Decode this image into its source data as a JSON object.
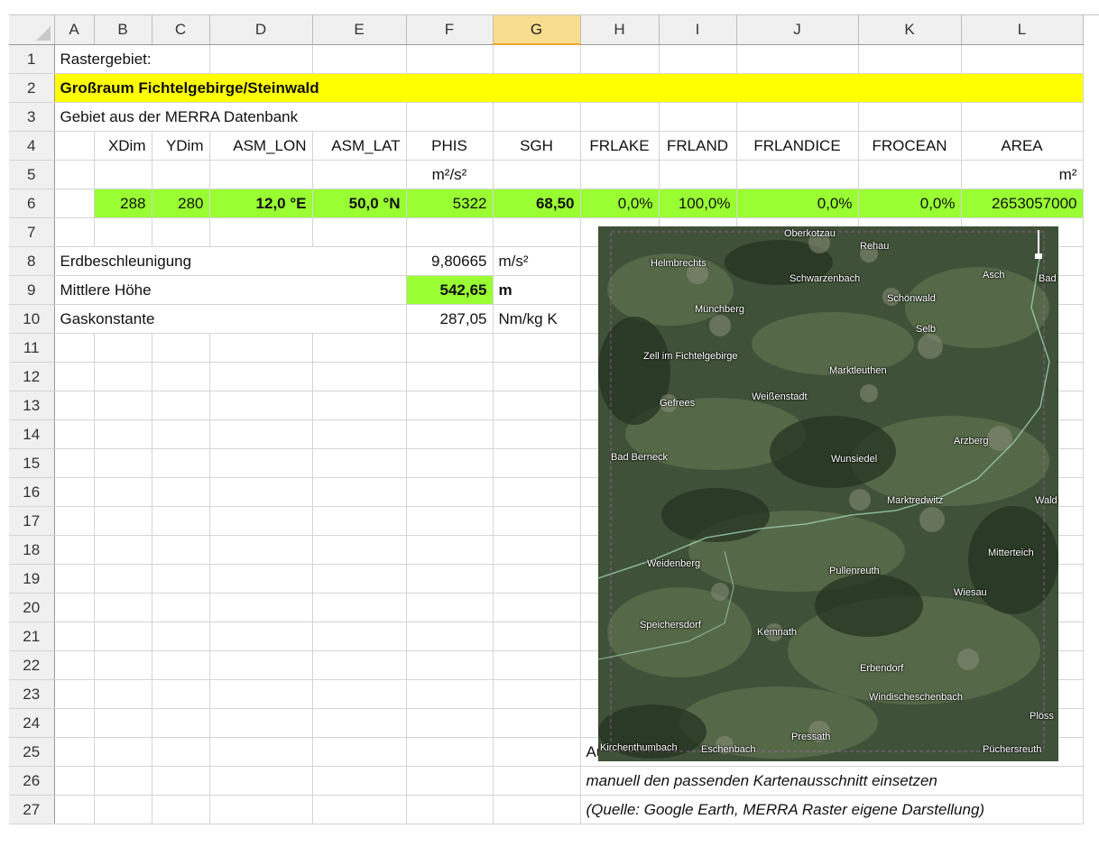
{
  "columns": [
    "A",
    "B",
    "C",
    "D",
    "E",
    "F",
    "G",
    "H",
    "I",
    "J",
    "K",
    "L"
  ],
  "rows": [
    "1",
    "2",
    "3",
    "4",
    "5",
    "6",
    "7",
    "8",
    "9",
    "10",
    "11",
    "12",
    "13",
    "14",
    "15",
    "16",
    "17",
    "18",
    "19",
    "20",
    "21",
    "22",
    "23",
    "24",
    "25",
    "26",
    "27"
  ],
  "cells": {
    "a1": "Rastergebiet:",
    "a2": "Großraum Fichtelgebirge/Steinwald",
    "a3": "Gebiet aus der MERRA Datenbank",
    "b4": "XDim",
    "c4": "YDim",
    "d4": "ASM_LON",
    "e4": "ASM_LAT",
    "f4": "PHIS",
    "g4": "SGH",
    "h4": "FRLAKE",
    "i4": "FRLAND",
    "j4": "FRLANDICE",
    "k4": "FROCEAN",
    "l4": "AREA",
    "f5": "m²/s²",
    "l5": "m²",
    "b6": "288",
    "c6": "280",
    "d6": "12,0 °E",
    "e6": "50,0 °N",
    "f6": "5322",
    "g6": "68,50",
    "h6": "0,0%",
    "i6": "100,0%",
    "j6": "0,0%",
    "k6": "0,0%",
    "l6": "2653057000",
    "a8": "Erdbeschleunigung",
    "f8": "9,80665",
    "g8": "m/s²",
    "a9": "Mittlere Höhe",
    "f9": "542,65",
    "g9": "m",
    "a10": "Gaskonstante",
    "f10": "287,05",
    "g10": "Nm/kg K",
    "h25": "Ausschnitt mit dem Rastergebiet aus Google Earth",
    "h26": "manuell den passenden Kartenausschnitt einsetzen",
    "h27": "(Quelle: Google Earth, MERRA Raster eigene Darstellung)"
  },
  "map_labels": [
    "Oberkotzau",
    "Rehau",
    "Helmbrechts",
    "Schwarzenbach",
    "Asch",
    "Bad",
    "Schönwald",
    "Münchberg",
    "Selb",
    "Zell im Fichtelgebirge",
    "Marktleuthen",
    "Gefrees",
    "Weißenstadt",
    "Arzberg",
    "Bad Berneck",
    "Wunsiedel",
    "Marktredwitz",
    "Wald",
    "Mitterteich",
    "Weidenberg",
    "Pullenreuth",
    "Wiesau",
    "Speichersdorf",
    "Kemnath",
    "Erbendorf",
    "Windischeschenbach",
    "Plöss",
    "Kirchenthumbach",
    "Eschenbach",
    "Pressath",
    "Püchersreuth"
  ]
}
